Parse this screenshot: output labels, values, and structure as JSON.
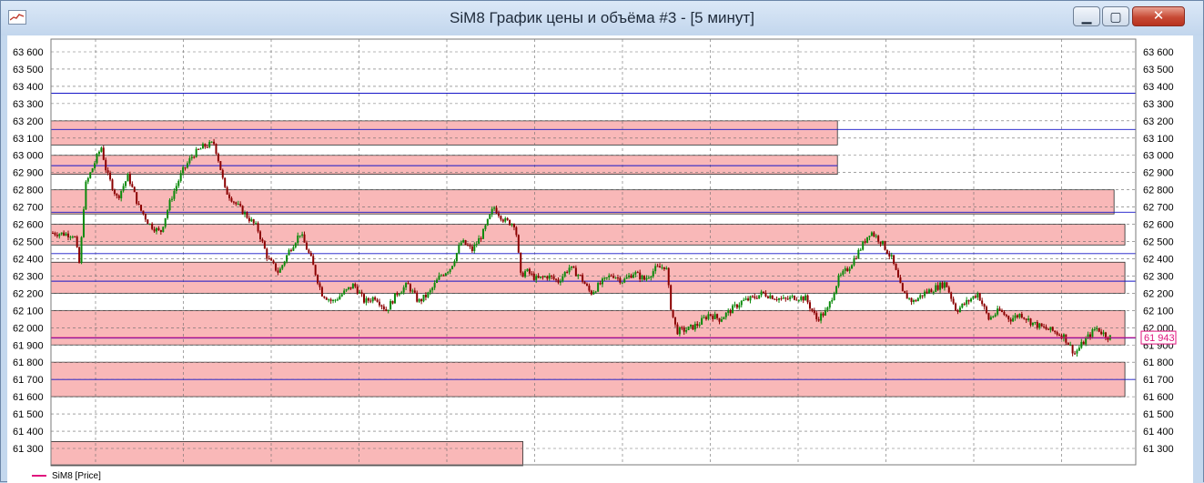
{
  "window": {
    "title": "SiM8 График цены и объёма #3 - [5 минут]",
    "minimize_icon": "minimize-icon",
    "maximize_icon": "maximize-icon",
    "close_icon": "close-icon"
  },
  "legend": {
    "label": "SiM8 [Price]",
    "color": "#e0147e"
  },
  "colors": {
    "band_fill": "#f9b8b8",
    "level_line": "#1515c8",
    "candle_up": "#0b8a0b",
    "candle_down": "#8b0000",
    "current_price": "#e0147e"
  },
  "chart_data": {
    "type": "candlestick",
    "title": "",
    "xlabel": "",
    "ylabel": "",
    "ylim": [
      61200,
      63650
    ],
    "y_ticks": [
      "63 600",
      "63 500",
      "63 400",
      "63 300",
      "63 200",
      "63 100",
      "63 000",
      "62 900",
      "62 800",
      "62 700",
      "62 600",
      "62 500",
      "62 400",
      "62 300",
      "62 200",
      "62 100",
      "62 000",
      "61 900",
      "61 800",
      "61 700",
      "61 600",
      "61 500",
      "61 400",
      "61 300"
    ],
    "grid": true,
    "current_price": {
      "label": "61 943",
      "value": 61943
    },
    "price_path": [
      [
        0.0,
        62550
      ],
      [
        0.02,
        62540
      ],
      [
        0.025,
        62360
      ],
      [
        0.03,
        62820
      ],
      [
        0.045,
        63050
      ],
      [
        0.05,
        62900
      ],
      [
        0.06,
        62750
      ],
      [
        0.07,
        62880
      ],
      [
        0.08,
        62700
      ],
      [
        0.09,
        62600
      ],
      [
        0.1,
        62550
      ],
      [
        0.11,
        62750
      ],
      [
        0.12,
        62900
      ],
      [
        0.13,
        63000
      ],
      [
        0.14,
        63050
      ],
      [
        0.15,
        63070
      ],
      [
        0.155,
        62950
      ],
      [
        0.16,
        62800
      ],
      [
        0.17,
        62720
      ],
      [
        0.18,
        62650
      ],
      [
        0.19,
        62580
      ],
      [
        0.2,
        62400
      ],
      [
        0.21,
        62320
      ],
      [
        0.22,
        62450
      ],
      [
        0.23,
        62550
      ],
      [
        0.24,
        62400
      ],
      [
        0.25,
        62200
      ],
      [
        0.26,
        62150
      ],
      [
        0.27,
        62200
      ],
      [
        0.28,
        62250
      ],
      [
        0.29,
        62150
      ],
      [
        0.3,
        62180
      ],
      [
        0.31,
        62100
      ],
      [
        0.32,
        62200
      ],
      [
        0.33,
        62250
      ],
      [
        0.34,
        62150
      ],
      [
        0.35,
        62200
      ],
      [
        0.36,
        62300
      ],
      [
        0.37,
        62350
      ],
      [
        0.38,
        62500
      ],
      [
        0.39,
        62450
      ],
      [
        0.4,
        62550
      ],
      [
        0.41,
        62700
      ],
      [
        0.42,
        62620
      ],
      [
        0.43,
        62600
      ],
      [
        0.435,
        62300
      ],
      [
        0.44,
        62330
      ],
      [
        0.45,
        62280
      ],
      [
        0.46,
        62300
      ],
      [
        0.47,
        62270
      ],
      [
        0.48,
        62350
      ],
      [
        0.49,
        62300
      ],
      [
        0.5,
        62200
      ],
      [
        0.51,
        62260
      ],
      [
        0.52,
        62310
      ],
      [
        0.53,
        62270
      ],
      [
        0.54,
        62320
      ],
      [
        0.55,
        62280
      ],
      [
        0.56,
        62340
      ],
      [
        0.57,
        62360
      ],
      [
        0.575,
        62100
      ],
      [
        0.58,
        61980
      ],
      [
        0.59,
        61990
      ],
      [
        0.6,
        62020
      ],
      [
        0.61,
        62080
      ],
      [
        0.62,
        62050
      ],
      [
        0.63,
        62100
      ],
      [
        0.64,
        62150
      ],
      [
        0.65,
        62170
      ],
      [
        0.66,
        62200
      ],
      [
        0.67,
        62180
      ],
      [
        0.68,
        62160
      ],
      [
        0.69,
        62180
      ],
      [
        0.7,
        62170
      ],
      [
        0.71,
        62050
      ],
      [
        0.72,
        62100
      ],
      [
        0.73,
        62280
      ],
      [
        0.74,
        62350
      ],
      [
        0.75,
        62450
      ],
      [
        0.76,
        62560
      ],
      [
        0.77,
        62500
      ],
      [
        0.78,
        62400
      ],
      [
        0.79,
        62200
      ],
      [
        0.8,
        62150
      ],
      [
        0.81,
        62200
      ],
      [
        0.82,
        62230
      ],
      [
        0.83,
        62260
      ],
      [
        0.84,
        62100
      ],
      [
        0.85,
        62150
      ],
      [
        0.86,
        62200
      ],
      [
        0.87,
        62050
      ],
      [
        0.88,
        62100
      ],
      [
        0.89,
        62050
      ],
      [
        0.9,
        62080
      ],
      [
        0.91,
        62030
      ],
      [
        0.92,
        62000
      ],
      [
        0.93,
        61980
      ],
      [
        0.94,
        61950
      ],
      [
        0.95,
        61850
      ],
      [
        0.96,
        61930
      ],
      [
        0.97,
        62000
      ],
      [
        0.98,
        61950
      ],
      [
        0.985,
        61943
      ]
    ]
  }
}
